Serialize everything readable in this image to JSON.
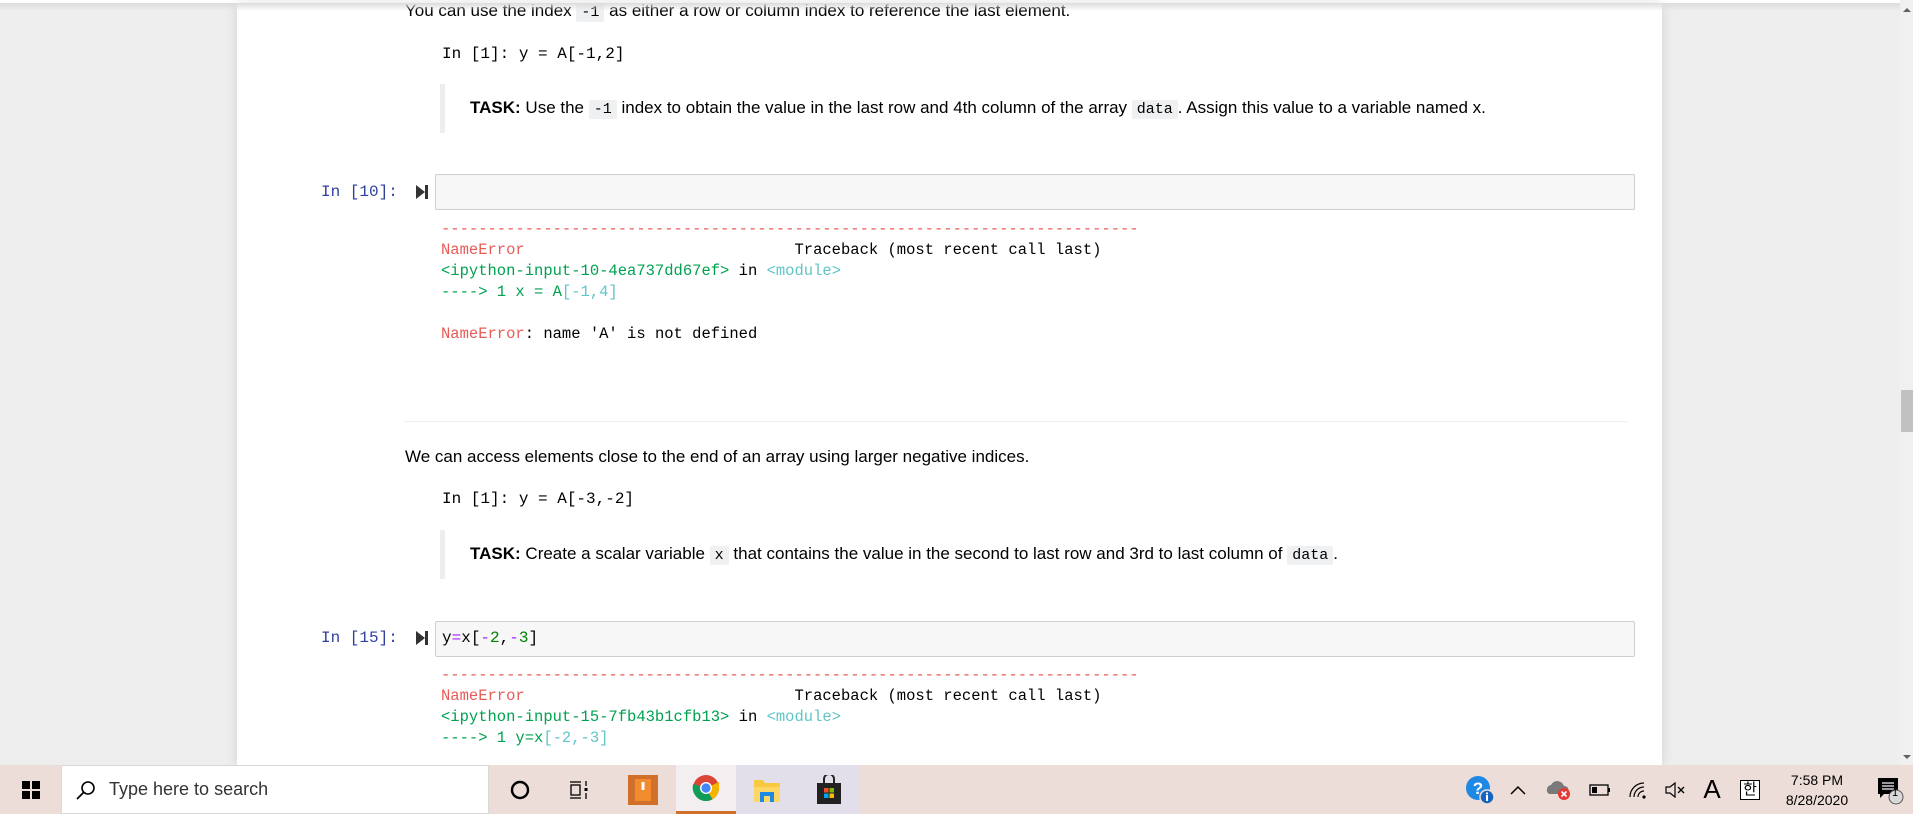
{
  "section1": {
    "intro_before": "You can use the index ",
    "intro_code": "-1",
    "intro_after": " as either a row or column index to reference the last element.",
    "example": "In  [1]: y = A[-1,2]",
    "task_label": "TASK:",
    "task_before": " Use the ",
    "task_code1": "-1",
    "task_mid": " index to obtain the value in the last row and 4th column of the array ",
    "task_code2": "data",
    "task_after": ". Assign this value to a variable named x."
  },
  "cell1": {
    "prompt": "In [10]:",
    "code": "",
    "traceback": {
      "dashes": "---------------------------------------------------------------------------",
      "error_name": "NameError",
      "traceback_header": "Traceback (most recent call last)",
      "input_ref": "<ipython-input-10-4ea737dd67ef>",
      "in_word": " in ",
      "module": "<module>",
      "arrow_line_prefix": "----> 1 x = A",
      "arrow_line_index": "[-1,4]",
      "final_error_name": "NameError",
      "final_error_msg": ": name 'A' is not defined"
    }
  },
  "section2": {
    "intro": "We can access elements close to the end of an array using larger negative indices.",
    "example": "In  [1]: y =  A[-3,-2]",
    "task_label": "TASK:",
    "task_before": " Create a scalar variable ",
    "task_code1": "x",
    "task_mid": " that contains the value in the second to last row and 3rd to last column of ",
    "task_code2": "data",
    "task_after": "."
  },
  "cell2": {
    "prompt": "In [15]:",
    "code_tokens": [
      "y",
      "=",
      "x[",
      "-",
      "2",
      ",",
      "-",
      "3",
      "]"
    ],
    "traceback": {
      "dashes": "---------------------------------------------------------------------------",
      "error_name": "NameError",
      "traceback_header": "Traceback (most recent call last)",
      "input_ref": "<ipython-input-15-7fb43b1cfb13>",
      "in_word": " in ",
      "module": "<module>",
      "arrow_line_prefix": "----> 1 y=x",
      "arrow_line_index": "[-2,-3]"
    }
  },
  "taskbar": {
    "search_placeholder": "Type here to search",
    "time": "7:58 PM",
    "date": "8/28/2020",
    "ime_letter": "A",
    "ime_korean": "한",
    "notification_count": "1",
    "icons": [
      "windows-start",
      "search",
      "cortana",
      "task-view",
      "app-orange",
      "chrome",
      "file-explorer",
      "microsoft-store",
      "help",
      "show-hidden-icons",
      "onedrive-error",
      "battery",
      "network",
      "volume-muted",
      "input-mode",
      "ime-korean",
      "action-center"
    ]
  },
  "colors": {
    "prompt": "#303f9f",
    "error_red": "#e75c58",
    "ansi_green": "#00a250",
    "ansi_cyan": "#60c6c8",
    "taskbar_bg": "#ecddd8"
  }
}
